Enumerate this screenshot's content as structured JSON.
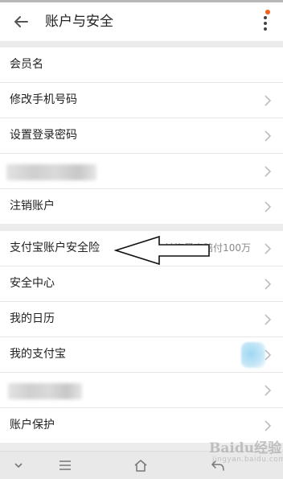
{
  "header": {
    "title": "账户与安全",
    "back_icon": "arrow-left-icon",
    "more_icon": "more-vertical-icon"
  },
  "group1": [
    {
      "label": "会员名",
      "chevron": false
    },
    {
      "label": "修改手机号码",
      "chevron": true
    },
    {
      "label": "设置登录密码",
      "chevron": true
    },
    {
      "label": "",
      "redacted": true,
      "chevron": true
    },
    {
      "label": "注销账户",
      "chevron": true
    }
  ],
  "group2": [
    {
      "label": "支付宝账户安全险",
      "hint": "被盗最高赔付100万",
      "chevron": true
    },
    {
      "label": "安全中心",
      "chevron": true
    },
    {
      "label": "我的日历",
      "chevron": true
    },
    {
      "label": "我的支付宝",
      "chevron": true
    },
    {
      "label": "",
      "redacted": true,
      "chevron": true
    },
    {
      "label": "账户保护",
      "chevron": true
    }
  ],
  "watermark": {
    "text": "Baidu经验",
    "sub": "jingyan.baidu.com"
  },
  "colors": {
    "accent_dot": "#f0601f",
    "chevron": "#bdbdbd",
    "background": "#ececec"
  }
}
